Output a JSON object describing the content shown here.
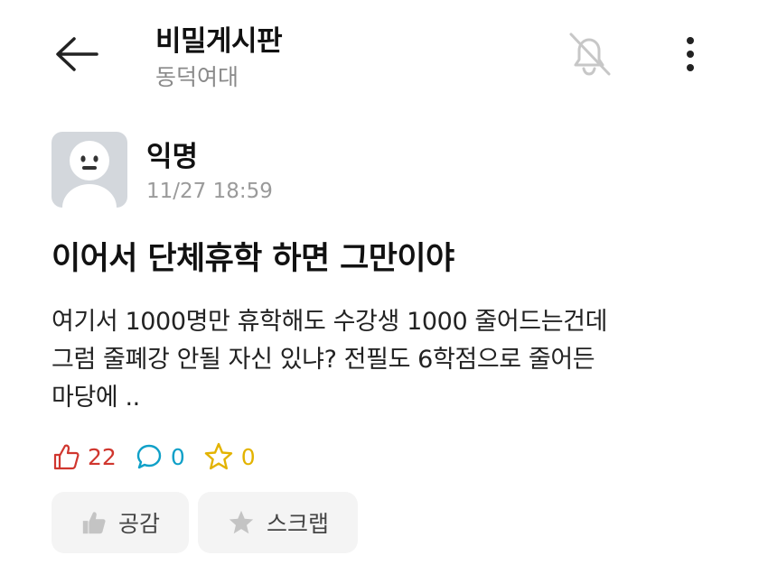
{
  "header": {
    "board_name": "비밀게시판",
    "school": "동덕여대"
  },
  "post": {
    "author": "익명",
    "time": "11/27 18:59",
    "title": "이어서 단체휴학 하면 그만이야",
    "body": "여기서 1000명만 휴학해도 수강생 1000 줄어드는건데\n그럼 줄폐강 안될 자신 있냐? 전필도 6학점으로 줄어든\n마당에 .."
  },
  "stats": {
    "likes": "22",
    "comments": "0",
    "scraps": "0"
  },
  "actions": {
    "empathy_label": "공감",
    "scrap_label": "스크랩"
  },
  "colors": {
    "like": "#d0362e",
    "comment": "#0fa0c8",
    "scrap": "#e3b300",
    "avatar_bg": "#d3d7dc"
  },
  "icons": [
    "arrow-left-icon",
    "bell-off-icon",
    "more-vertical-icon",
    "thumbs-up-icon",
    "comment-icon",
    "star-icon"
  ]
}
